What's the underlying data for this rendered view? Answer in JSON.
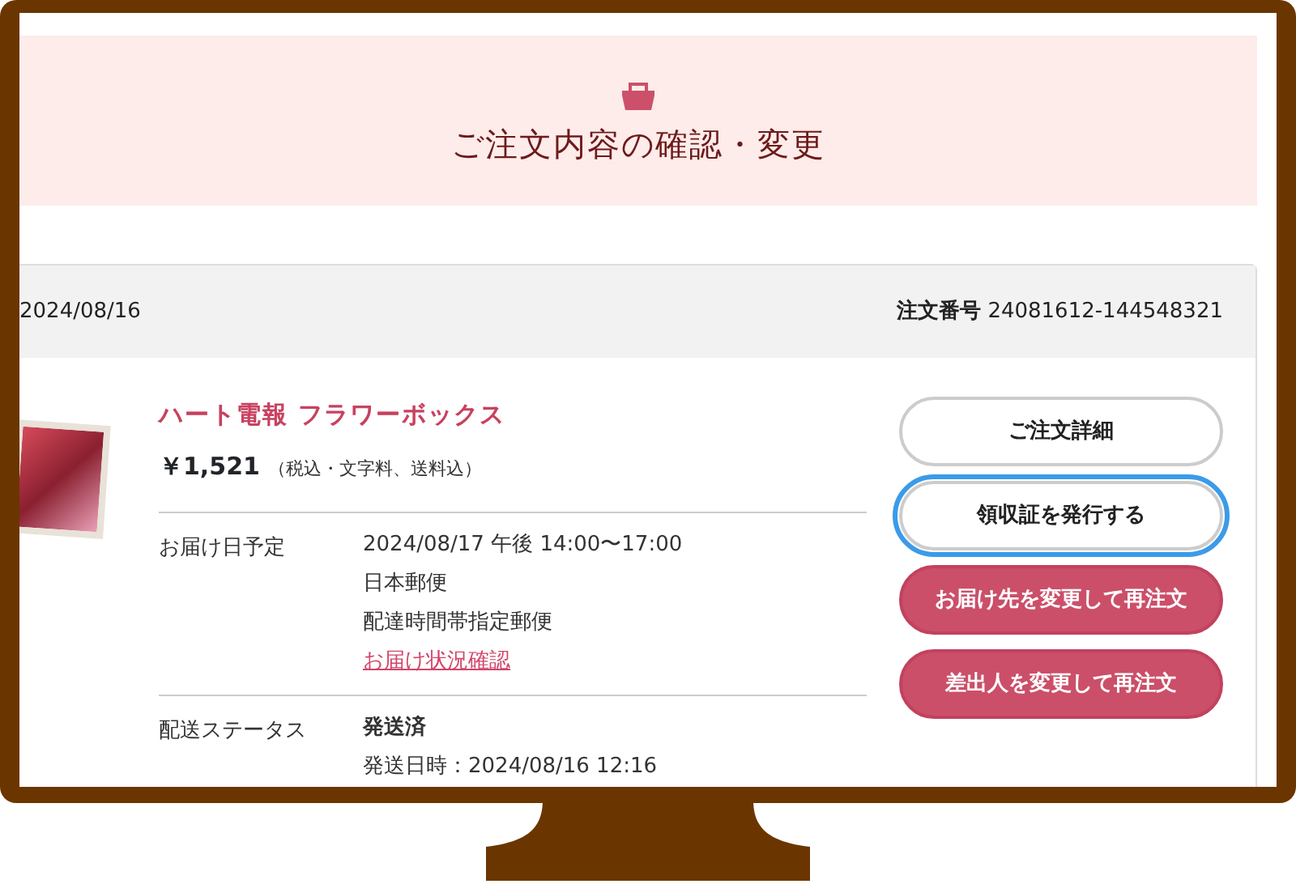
{
  "header": {
    "title": "ご注文内容の確認・変更"
  },
  "order": {
    "date": "2024/08/16",
    "number_label": "注文番号",
    "number": "24081612-144548321"
  },
  "product": {
    "name": "ハート電報 フラワーボックス",
    "price": "￥1,521",
    "price_note": "（税込・文字料、送料込）"
  },
  "details": [
    {
      "label": "お届け日予定",
      "lines": [
        {
          "kind": "text",
          "text": "2024/08/17 午後 14:00〜17:00"
        },
        {
          "kind": "text",
          "text": "日本郵便"
        },
        {
          "kind": "text",
          "text": "配達時間帯指定郵便"
        },
        {
          "kind": "link",
          "text": "お届け状況確認"
        }
      ]
    },
    {
      "label": "配送ステータス",
      "lines": [
        {
          "kind": "strong",
          "text": "発送済"
        },
        {
          "kind": "text",
          "text": "発送日時：2024/08/16 12:16"
        }
      ]
    }
  ],
  "buttons": [
    {
      "label": "ご注文詳細",
      "kind": "outline",
      "highlighted": false
    },
    {
      "label": "領収証を発行する",
      "kind": "outline",
      "highlighted": true
    },
    {
      "label": "お届け先を変更して再注文",
      "kind": "filled",
      "highlighted": false
    },
    {
      "label": "差出人を変更して再注文",
      "kind": "filled",
      "highlighted": false
    }
  ]
}
